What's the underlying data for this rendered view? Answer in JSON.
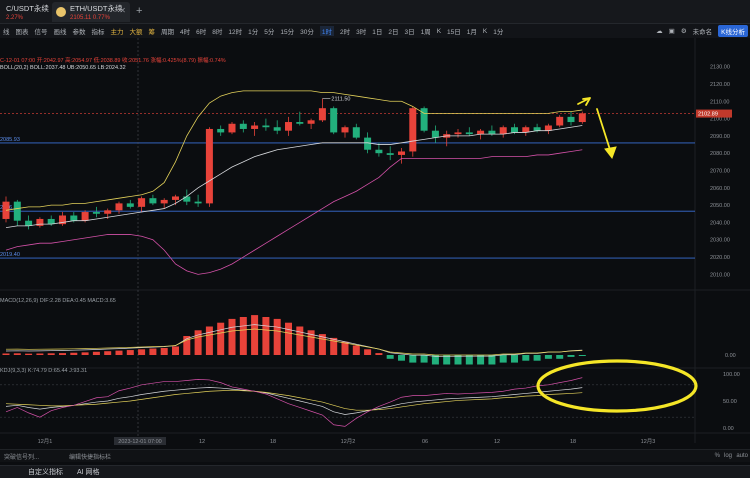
{
  "tabs": [
    {
      "symbol": "C/USDT永续",
      "price": "2.27%"
    },
    {
      "symbol": "ETH/USDT永续",
      "price": "2105.11  0.77%"
    }
  ],
  "toolbar": {
    "items": [
      "线",
      "图表",
      "信号",
      "画线",
      "参数",
      "指标",
      "主力",
      "大额",
      "筹",
      "周期",
      "4时",
      "6时",
      "8时",
      "12时",
      "1分",
      "5分",
      "15分",
      "30分",
      "1时",
      "2时",
      "3时",
      "1日",
      "2日",
      "3日",
      "1周",
      "K",
      "15日",
      "1月",
      "K",
      "1分"
    ],
    "selected_index": 18,
    "right_items": [
      "未命名",
      "K线分析"
    ]
  },
  "legends": {
    "main_top": "C-12-01 07:00  开:2042.97  高:2054.97  低:2038.89  收:2051.76  涨幅:0.425%(8.79)  振幅:0.74%",
    "boll": "BOLL(20,2)  BOLL:2037.48  UB:2050.65  LB:2024.32",
    "macd": "MACD(12,26,9)  DIF:2.28  DEA:0.45  MACD:3.65",
    "kdj": "KDJ(9,3,3)  K:74.79  D:65.44  J:93.31"
  },
  "annotations": {
    "high_label": "2111.50",
    "line_label_1": "2085.93",
    "line_label_2": "2046.49",
    "line_label_3": "2019.40"
  },
  "price_axis": [
    "2130.00",
    "2120.00",
    "2110.00",
    "2100.00",
    "2090.00",
    "2080.00",
    "2070.00",
    "2060.00",
    "2050.00",
    "2040.00",
    "2030.00",
    "2020.00",
    "2010.00"
  ],
  "current_price": "2102.89",
  "macd_axis": [
    "0.00"
  ],
  "kdj_axis": [
    "100.00",
    "50.00",
    "0.00"
  ],
  "time_axis": [
    "12月1",
    "2023-12-01 07:00",
    "12",
    "18",
    "12月2",
    "06",
    "12",
    "18",
    "12月3"
  ],
  "statusbar": {
    "left": "突破信号列...",
    "middle": "编辑快捷指标栏",
    "right_items": [
      "%",
      "log",
      "auto"
    ]
  },
  "bottombar": [
    "自定义指标",
    "AI 网格"
  ],
  "colors": {
    "up": "#e8433a",
    "down": "#22b07d",
    "boll_mid": "#d7d9dd",
    "boll_upper": "#e3d15a",
    "boll_lower": "#d451a8",
    "blue_line": "#3a6fd6",
    "annotation": "#f5e627"
  },
  "chart_data": {
    "type": "candlestick",
    "candles": [
      [
        2042,
        2055,
        2040,
        2052,
        "up"
      ],
      [
        2052,
        2053,
        2038,
        2041,
        "down"
      ],
      [
        2041,
        2044,
        2036,
        2038,
        "down"
      ],
      [
        2038,
        2043,
        2037,
        2042,
        "up"
      ],
      [
        2042,
        2044,
        2038,
        2039,
        "down"
      ],
      [
        2039,
        2046,
        2038,
        2044,
        "up"
      ],
      [
        2044,
        2046,
        2040,
        2041,
        "down"
      ],
      [
        2041,
        2047,
        2040,
        2046,
        "up"
      ],
      [
        2046,
        2049,
        2043,
        2045,
        "down"
      ],
      [
        2045,
        2048,
        2042,
        2047,
        "up"
      ],
      [
        2047,
        2052,
        2045,
        2051,
        "up"
      ],
      [
        2051,
        2053,
        2048,
        2049,
        "down"
      ],
      [
        2049,
        2055,
        2046,
        2054,
        "up"
      ],
      [
        2054,
        2056,
        2050,
        2051,
        "down"
      ],
      [
        2051,
        2054,
        2048,
        2053,
        "up"
      ],
      [
        2053,
        2056,
        2050,
        2055,
        "up"
      ],
      [
        2055,
        2059,
        2050,
        2052,
        "down"
      ],
      [
        2052,
        2056,
        2049,
        2051,
        "down"
      ],
      [
        2051,
        2095,
        2049,
        2094,
        "up"
      ],
      [
        2094,
        2096,
        2090,
        2092,
        "down"
      ],
      [
        2092,
        2098,
        2091,
        2097,
        "up"
      ],
      [
        2097,
        2099,
        2092,
        2094,
        "down"
      ],
      [
        2094,
        2098,
        2090,
        2096,
        "up"
      ],
      [
        2096,
        2100,
        2093,
        2095,
        "down"
      ],
      [
        2095,
        2099,
        2091,
        2093,
        "down"
      ],
      [
        2093,
        2101,
        2090,
        2098,
        "up"
      ],
      [
        2098,
        2104,
        2096,
        2097,
        "down"
      ],
      [
        2097,
        2100,
        2094,
        2099,
        "up"
      ],
      [
        2099,
        2111.5,
        2098,
        2106,
        "up"
      ],
      [
        2106,
        2107,
        2091,
        2092,
        "down"
      ],
      [
        2092,
        2096,
        2089,
        2095,
        "up"
      ],
      [
        2095,
        2097,
        2088,
        2089,
        "down"
      ],
      [
        2089,
        2092,
        2080,
        2082,
        "down"
      ],
      [
        2082,
        2086,
        2078,
        2080,
        "down"
      ],
      [
        2080,
        2084,
        2076,
        2079,
        "down"
      ],
      [
        2079,
        2083,
        2074,
        2081,
        "up"
      ],
      [
        2081,
        2107,
        2078,
        2106,
        "up"
      ],
      [
        2106,
        2107,
        2092,
        2093,
        "down"
      ],
      [
        2093,
        2096,
        2086,
        2089,
        "down"
      ],
      [
        2089,
        2093,
        2084,
        2091,
        "up"
      ],
      [
        2091,
        2094,
        2089,
        2092,
        "up"
      ],
      [
        2092,
        2095,
        2090,
        2091,
        "down"
      ],
      [
        2091,
        2094,
        2088,
        2093,
        "up"
      ],
      [
        2093,
        2096,
        2090,
        2091,
        "down"
      ],
      [
        2091,
        2096,
        2089,
        2095,
        "up"
      ],
      [
        2095,
        2097,
        2091,
        2092,
        "down"
      ],
      [
        2092,
        2096,
        2090,
        2095,
        "up"
      ],
      [
        2095,
        2097,
        2092,
        2093,
        "down"
      ],
      [
        2093,
        2097,
        2091,
        2096,
        "up"
      ],
      [
        2096,
        2102,
        2095,
        2101,
        "up"
      ],
      [
        2101,
        2104,
        2096,
        2098,
        "down"
      ],
      [
        2098,
        2104,
        2097,
        2103,
        "up"
      ]
    ],
    "boll_upper": [
      2047,
      2048,
      2049,
      2049,
      2050,
      2050,
      2051,
      2051,
      2052,
      2053,
      2054,
      2055,
      2056,
      2058,
      2063,
      2075,
      2090,
      2101,
      2109,
      2113,
      2115,
      2116,
      2116,
      2116,
      2116,
      2116,
      2116,
      2116,
      2115,
      2115,
      2114,
      2113,
      2112,
      2111,
      2110,
      2110,
      2107,
      2103,
      2103,
      2103,
      2103,
      2103,
      2103,
      2103,
      2103,
      2103,
      2103,
      2103,
      2103,
      2104,
      2104,
      2105
    ],
    "boll_mid": [
      2037,
      2038,
      2038,
      2039,
      2039,
      2040,
      2041,
      2041,
      2042,
      2043,
      2044,
      2045,
      2046,
      2047,
      2048,
      2051,
      2055,
      2060,
      2064,
      2068,
      2072,
      2075,
      2078,
      2080,
      2082,
      2083,
      2084,
      2085,
      2086,
      2086,
      2086,
      2086,
      2086,
      2085,
      2085,
      2086,
      2087,
      2088,
      2089,
      2090,
      2090,
      2090,
      2091,
      2091,
      2091,
      2092,
      2092,
      2093,
      2093,
      2094,
      2095,
      2096
    ],
    "boll_lower": [
      2024,
      2026,
      2027,
      2028,
      2028,
      2029,
      2030,
      2031,
      2032,
      2033,
      2033,
      2033,
      2032,
      2030,
      2024,
      2016,
      2012,
      2010,
      2011,
      2013,
      2016,
      2020,
      2024,
      2028,
      2032,
      2036,
      2040,
      2044,
      2048,
      2052,
      2055,
      2058,
      2062,
      2066,
      2072,
      2077,
      2077,
      2077,
      2077,
      2077,
      2077,
      2077,
      2077,
      2078,
      2078,
      2078,
      2078,
      2079,
      2079,
      2080,
      2081,
      2082
    ],
    "macd_hist": [
      0.8,
      0.9,
      0.7,
      0.8,
      0.9,
      1.0,
      1.2,
      1.4,
      1.7,
      2.0,
      2.3,
      2.6,
      3.0,
      3.4,
      3.7,
      4.5,
      10,
      13,
      15,
      17,
      19,
      20,
      21,
      20,
      19,
      17,
      15,
      13,
      11,
      9,
      7,
      5,
      3,
      1,
      -2,
      -3,
      -4,
      -4,
      -5,
      -5,
      -5,
      -5,
      -5,
      -5,
      -4,
      -4,
      -3,
      -3,
      -2,
      -2,
      -1,
      -0.5
    ],
    "kdj_k": [
      40,
      42,
      38,
      35,
      38,
      40,
      42,
      45,
      48,
      50,
      55,
      58,
      62,
      65,
      68,
      70,
      72,
      74,
      75,
      74,
      72,
      70,
      68,
      65,
      60,
      55,
      50,
      45,
      40,
      30,
      25,
      28,
      32,
      36,
      40,
      45,
      48,
      50,
      52,
      54,
      55,
      56,
      57,
      58,
      60,
      62,
      64,
      66,
      68,
      70,
      72,
      74.79
    ],
    "kdj_d": [
      45,
      44,
      43,
      42,
      41,
      41,
      42,
      43,
      44,
      46,
      48,
      50,
      53,
      56,
      59,
      62,
      64,
      66,
      68,
      69,
      70,
      69,
      68,
      66,
      63,
      60,
      56,
      52,
      48,
      42,
      36,
      33,
      33,
      34,
      36,
      39,
      42,
      45,
      47,
      49,
      51,
      52,
      53,
      54,
      56,
      57,
      59,
      60,
      62,
      63,
      64,
      65.44
    ],
    "kdj_j": [
      30,
      38,
      28,
      20,
      32,
      38,
      42,
      49,
      56,
      58,
      69,
      74,
      80,
      83,
      86,
      86,
      88,
      90,
      89,
      84,
      76,
      72,
      68,
      63,
      54,
      45,
      38,
      31,
      24,
      6,
      3,
      18,
      30,
      40,
      48,
      57,
      60,
      60,
      62,
      64,
      63,
      64,
      65,
      66,
      68,
      72,
      74,
      78,
      80,
      84,
      88,
      93.31
    ],
    "horizontal_lines": [
      2085.93,
      2046.49,
      2019.4
    ],
    "ylim_price": [
      2005,
      2135
    ]
  }
}
